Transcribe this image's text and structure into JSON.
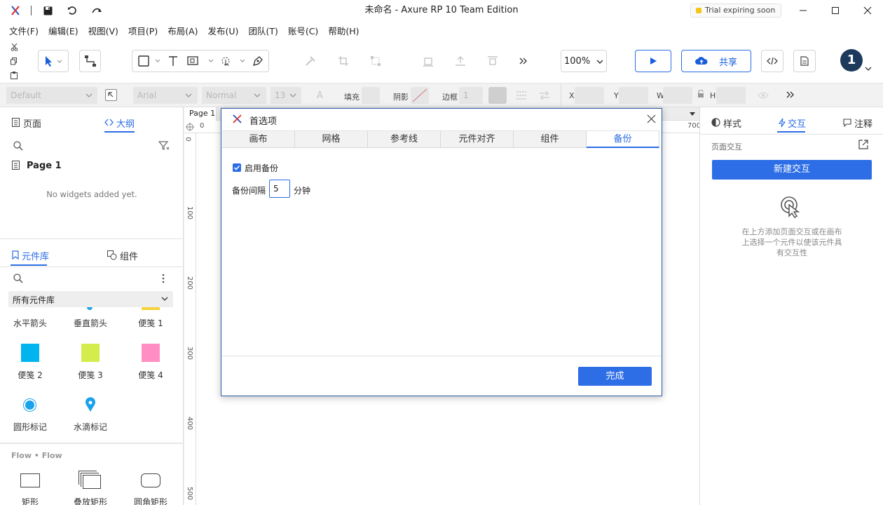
{
  "titlebar": {
    "title": "未命名 - Axure RP 10 Team Edition",
    "trial_label": "Trial expiring soon"
  },
  "menu": [
    "文件(F)",
    "编辑(E)",
    "视图(V)",
    "项目(P)",
    "布局(A)",
    "发布(U)",
    "团队(T)",
    "账号(C)",
    "帮助(H)"
  ],
  "toolbar": {
    "zoom": "100%",
    "share_label": "共享",
    "user_badge": "1"
  },
  "formatbar": {
    "style_value": "Default",
    "font_value": "Arial",
    "weight_value": "Normal",
    "size_value": "13",
    "fill_label": "填充",
    "shadow_label": "阴影",
    "border_label": "边框",
    "border_value": "1",
    "x_label": "X",
    "y_label": "Y",
    "w_label": "W",
    "h_label": "H"
  },
  "left": {
    "tab_pages": "页面",
    "tab_outline": "大纲",
    "page_name": "Page 1",
    "empty_text": "No widgets added yet.",
    "tab_library": "元件库",
    "tab_components": "组件",
    "library_select": "所有元件库",
    "widgets": [
      {
        "label": "水平箭头"
      },
      {
        "label": "垂直箭头"
      },
      {
        "label": "便笺 1"
      },
      {
        "label": "便笺 2"
      },
      {
        "label": "便笺 3"
      },
      {
        "label": "便笺 4"
      },
      {
        "label": "圆形标记"
      },
      {
        "label": "水滴标记"
      }
    ],
    "flow_section": "Flow • Flow",
    "flow_items": [
      {
        "label": "矩形"
      },
      {
        "label": "叠放矩形"
      },
      {
        "label": "圆角矩形"
      }
    ]
  },
  "canvas": {
    "page_tab": "Page 1",
    "ruler_top": [
      "0",
      "700"
    ],
    "ruler_left": [
      "0",
      "100",
      "200",
      "300",
      "400",
      "500"
    ]
  },
  "right": {
    "tab_style": "样式",
    "tab_interaction": "交互",
    "tab_notes": "注释",
    "page_interaction_label": "页面交互",
    "new_interaction_button": "新建交互",
    "hint_line1": "在上方添加页面交互或在画布",
    "hint_line2": "上选择一个元件以使该元件具",
    "hint_line3": "有交互性"
  },
  "dialog": {
    "title": "首选项",
    "tabs": [
      "画布",
      "网格",
      "参考线",
      "元件对齐",
      "组件",
      "备份"
    ],
    "active_tab": "备份",
    "enable_backup_label": "启用备份",
    "enable_backup_checked": true,
    "interval_label": "备份间隔",
    "interval_value": "5",
    "interval_unit": "分钟",
    "done_button": "完成"
  },
  "colors": {
    "accent": "#2b6de6",
    "sticky_2": "#00b4f0",
    "sticky_3": "#d4ec4c",
    "sticky_4": "#ff8ec4",
    "sticky_1": "#f4d23a",
    "marker": "#1aa2ec"
  }
}
